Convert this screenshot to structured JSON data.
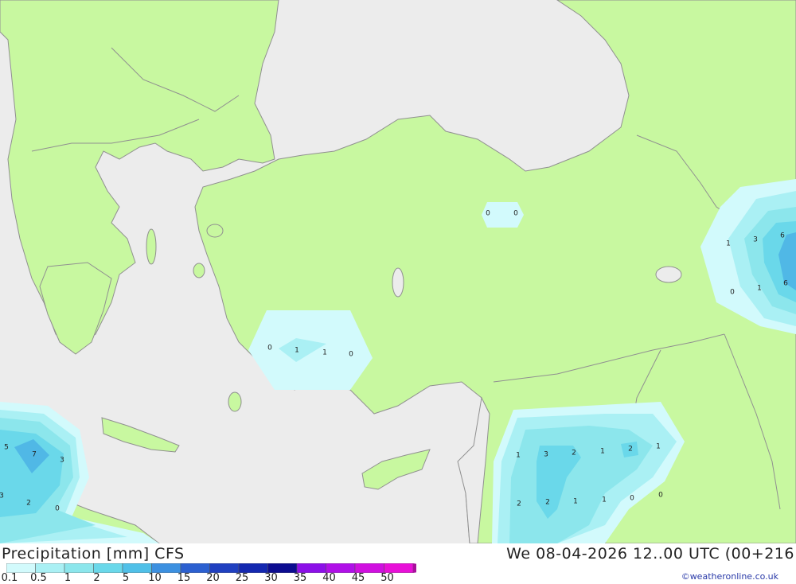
{
  "map": {
    "colors": {
      "sea": "#ececec",
      "land": "#c8f8a0",
      "border": "#909090",
      "precip_01": "#d2fafc",
      "precip_05": "#aaf0f4",
      "precip_1": "#8ce6ec",
      "precip_2": "#6ad8ea",
      "precip_5": "#50b8e6"
    },
    "precip_values": [
      {
        "group": "central-anatolia",
        "values": [
          "0",
          "0"
        ]
      },
      {
        "group": "west-anatolia",
        "values": [
          "0",
          "1",
          "1",
          "0"
        ]
      },
      {
        "group": "caucasus-east",
        "values": [
          "1",
          "3",
          "6",
          "0",
          "1",
          "6"
        ]
      },
      {
        "group": "syria-iraq",
        "values": [
          "1",
          "3",
          "2",
          "1",
          "2",
          "1",
          "2",
          "2",
          "1",
          "1",
          "0",
          "0"
        ]
      },
      {
        "group": "libya-coast",
        "values": [
          "5",
          "7",
          "3",
          "3",
          "2",
          "0"
        ]
      }
    ]
  },
  "legend": {
    "title": "Precipitation [mm] CFS",
    "datetime": "We 08-04-2026 12..00 UTC (00+216",
    "credit": "©weatheronline.co.uk",
    "ticks": [
      "0.1",
      "0.5",
      "1",
      "2",
      "5",
      "10",
      "15",
      "20",
      "25",
      "30",
      "35",
      "40",
      "45",
      "50"
    ],
    "colors": [
      "#d2fafc",
      "#aaf0f4",
      "#8ce6ec",
      "#6ad8ea",
      "#50c0e8",
      "#3c90e0",
      "#2c60d0",
      "#2040c0",
      "#1428b0",
      "#0c0c90",
      "#8c10e8",
      "#b010e8",
      "#d010e0",
      "#e810d8",
      "#a8109c"
    ]
  }
}
